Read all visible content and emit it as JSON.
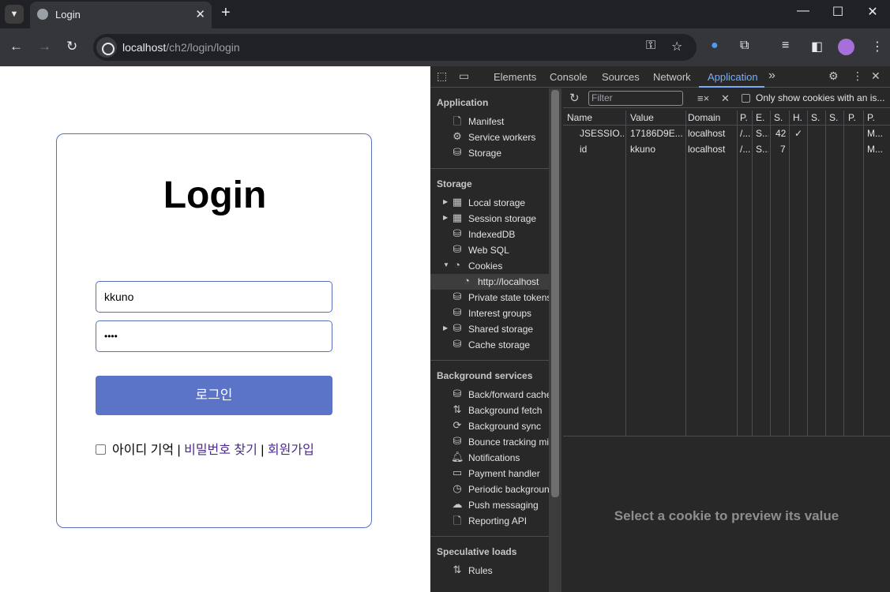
{
  "browser": {
    "tab_menu_icon": "chevron-down-icon",
    "tab_title": "Login",
    "tab_close": "✕",
    "new_tab": "+",
    "url_host": "localhost",
    "url_path": "/ch2/login/login"
  },
  "login": {
    "title": "Login",
    "username_value": "kkuno",
    "password_value": "••••",
    "button_label": "로그인",
    "remember_label": "아이디 기억",
    "sep1": " | ",
    "find_password": "비밀번호 찾기",
    "sep2": " | ",
    "signup": "회원가입"
  },
  "devtools": {
    "tabs": [
      "Elements",
      "Console",
      "Sources",
      "Network",
      "Application"
    ],
    "more_tabs": "»",
    "sidebar": {
      "application_header": "Application",
      "application_items": [
        "Manifest",
        "Service workers",
        "Storage"
      ],
      "storage_header": "Storage",
      "storage_items": [
        "Local storage",
        "Session storage",
        "IndexedDB",
        "Web SQL",
        "Cookies",
        "http://localhost",
        "Private state tokens",
        "Interest groups",
        "Shared storage",
        "Cache storage"
      ],
      "background_header": "Background services",
      "background_items": [
        "Back/forward cache",
        "Background fetch",
        "Background sync",
        "Bounce tracking mi",
        "Notifications",
        "Payment handler",
        "Periodic backgroun",
        "Push messaging",
        "Reporting API"
      ],
      "speculative_header": "Speculative loads",
      "speculative_items": [
        "Rules"
      ]
    },
    "filter_placeholder": "Filter",
    "only_show_label": "Only show cookies with an is...",
    "columns": [
      "Name",
      "Value",
      "Domain",
      "P.",
      "E.",
      "S.",
      "H.",
      "S.",
      "S.",
      "P.",
      "P."
    ],
    "rows": [
      [
        "JSESSIO...",
        "17186D9E...",
        "localhost",
        "/...",
        "S...",
        "42",
        "✓",
        "",
        "",
        "",
        "M..."
      ],
      [
        "id",
        "kkuno",
        "localhost",
        "/...",
        "S...",
        "7",
        "",
        "",
        "",
        "",
        "M..."
      ]
    ],
    "preview_text": "Select a cookie to preview its value"
  }
}
